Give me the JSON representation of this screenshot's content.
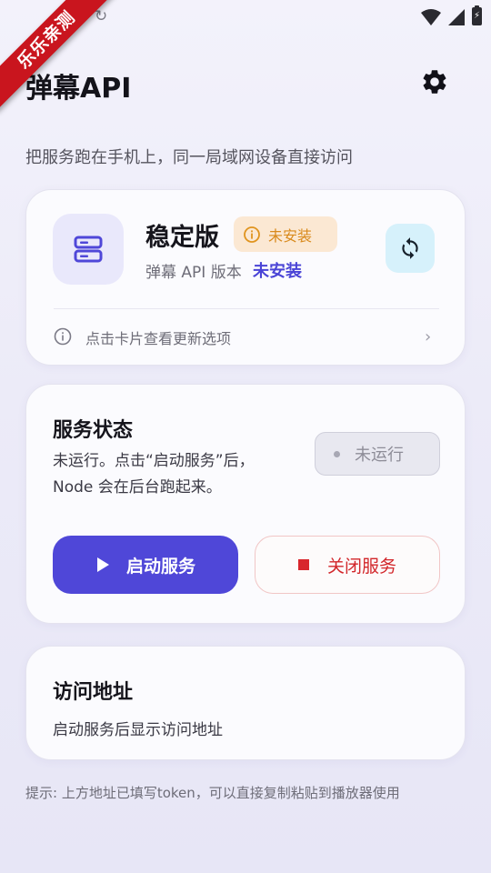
{
  "status_bar": {
    "battery_glyph": "⚡"
  },
  "ribbon": {
    "text": "乐乐亲测"
  },
  "header": {
    "title": "弹幕API",
    "settings_icon": "gear-icon",
    "subtitle": "把服务跑在手机上，同一局域网设备直接访问"
  },
  "version_card": {
    "name": "稳定版",
    "badge_text": "未安装",
    "version_label": "弹幕 API 版本",
    "version_value": "未安装",
    "hint": "点击卡片查看更新选项",
    "chevron": "›"
  },
  "service_card": {
    "title": "服务状态",
    "description": "未运行。点击“启动服务”后，Node 会在后台跑起来。",
    "status": "未运行",
    "start_label": "启动服务",
    "stop_label": "关闭服务"
  },
  "address_card": {
    "title": "访问地址",
    "description": "启动服务后显示访问地址"
  },
  "footer": {
    "tip": "提示: 上方地址已填写token，可以直接复制粘贴到播放器使用"
  },
  "colors": {
    "accent": "#4f47d8",
    "danger": "#d2262a",
    "warning": "#d98a1c",
    "ribbon": "#c9151e"
  }
}
